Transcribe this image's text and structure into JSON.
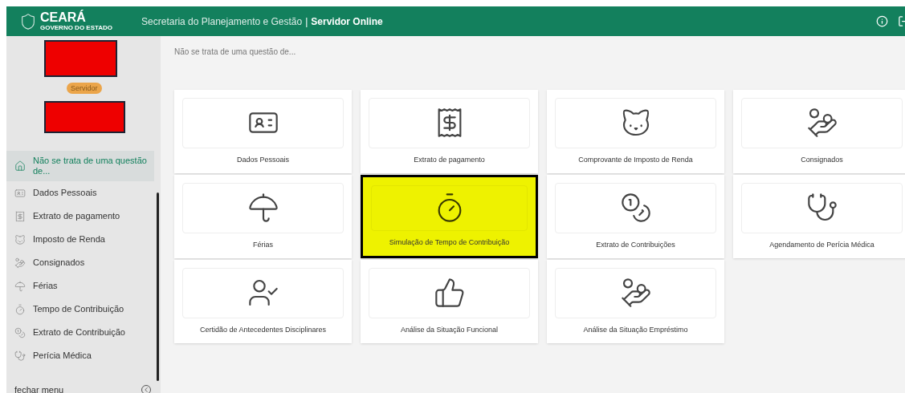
{
  "header": {
    "logo_title": "CEARÁ",
    "logo_subtitle": "GOVERNO DO ESTADO",
    "department": "Secretaria do Planejamento e Gestão",
    "separator": "|",
    "app_name": "Servidor Online"
  },
  "sidebar": {
    "role_badge": "Servidor",
    "items": [
      {
        "label": "Não se trata de uma questão de...",
        "kind": "home",
        "selected": true
      },
      {
        "label": "Dados Pessoais",
        "kind": "id-card",
        "selected": false
      },
      {
        "label": "Extrato de pagamento",
        "kind": "receipt",
        "selected": false
      },
      {
        "label": "Imposto de Renda",
        "kind": "lion",
        "selected": false
      },
      {
        "label": "Consignados",
        "kind": "hand-coin",
        "selected": false
      },
      {
        "label": "Férias",
        "kind": "umbrella",
        "selected": false
      },
      {
        "label": "Tempo de Contribuição",
        "kind": "timer",
        "selected": false
      },
      {
        "label": "Extrato de Contribuição",
        "kind": "coins",
        "selected": false
      },
      {
        "label": "Perícia Médica",
        "kind": "doctor",
        "selected": false
      }
    ],
    "close_menu": "fechar menu"
  },
  "breadcrumb": "Não se trata de uma questão de...",
  "cards": [
    {
      "label": "Dados Pessoais",
      "kind": "id-card",
      "highlighted": false
    },
    {
      "label": "Extrato de pagamento",
      "kind": "receipt",
      "highlighted": false
    },
    {
      "label": "Comprovante de Imposto de Renda",
      "kind": "lion",
      "highlighted": false
    },
    {
      "label": "Consignados",
      "kind": "hand-coin",
      "highlighted": false
    },
    {
      "label": "Férias",
      "kind": "umbrella",
      "highlighted": false
    },
    {
      "label": "Simulação de Tempo de Contribuição",
      "kind": "timer",
      "highlighted": true
    },
    {
      "label": "Extrato de Contribuições",
      "kind": "coins",
      "highlighted": false
    },
    {
      "label": "Agendamento de Perícia Médica",
      "kind": "doctor",
      "highlighted": false
    },
    {
      "label": "Certidão de Antecedentes Disciplinares",
      "kind": "certificate",
      "highlighted": false
    },
    {
      "label": "Análise da Situação Funcional",
      "kind": "thumbs-up",
      "highlighted": false
    },
    {
      "label": "Análise da Situação Empréstimo",
      "kind": "hand-coin",
      "highlighted": false
    }
  ]
}
